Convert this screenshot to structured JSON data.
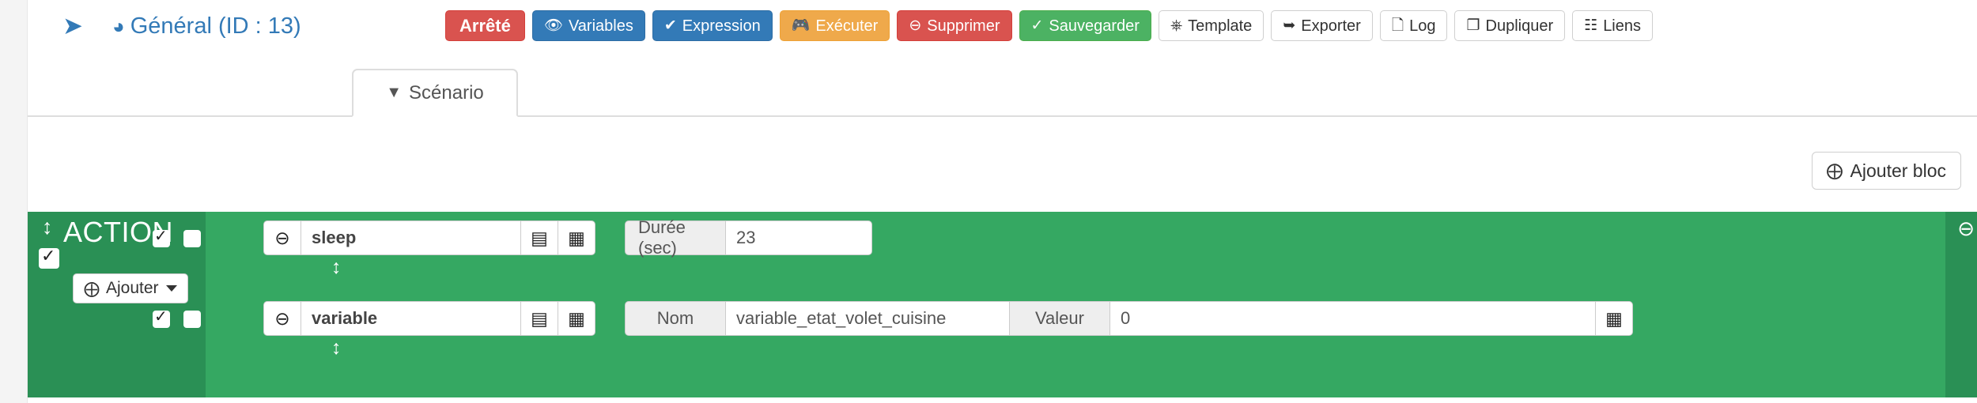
{
  "header": {
    "back_icon": "arrow-circle-left",
    "title": "Général (ID : 13)",
    "title_icon": "dashboard-icon",
    "buttons": [
      {
        "name": "status-badge",
        "label": "Arrêté",
        "icon": "",
        "style": "badge"
      },
      {
        "name": "variables-button",
        "label": "Variables",
        "icon": "eye-icon",
        "style": "primary"
      },
      {
        "name": "expression-button",
        "label": "Expression",
        "icon": "check-icon",
        "style": "primary"
      },
      {
        "name": "execute-button",
        "label": "Exécuter",
        "icon": "gamepad-icon",
        "style": "warning"
      },
      {
        "name": "delete-button",
        "label": "Supprimer",
        "icon": "minus-circle-icon",
        "style": "danger"
      },
      {
        "name": "save-button",
        "label": "Sauvegarder",
        "icon": "check-circle-icon",
        "style": "success"
      },
      {
        "name": "template-button",
        "label": "Template",
        "icon": "cubes-icon",
        "style": "default"
      },
      {
        "name": "export-button",
        "label": "Exporter",
        "icon": "share-icon",
        "style": "default"
      },
      {
        "name": "log-button",
        "label": "Log",
        "icon": "file-text-icon",
        "style": "default"
      },
      {
        "name": "duplicate-button",
        "label": "Dupliquer",
        "icon": "copy-icon",
        "style": "default"
      },
      {
        "name": "links-button",
        "label": "Liens",
        "icon": "object-group-icon",
        "style": "default"
      }
    ]
  },
  "tabs": [
    {
      "name": "tab-scenario",
      "label": "Scénario",
      "icon": "filter-icon",
      "active": true
    }
  ],
  "toolbar": {
    "add_block_label": "Ajouter bloc",
    "add_block_icon": "plus-circle-icon"
  },
  "block": {
    "title": "ACTION",
    "sort_icon": "arrows-v-icon",
    "enabled_checked": true,
    "add_label": "Ajouter",
    "add_icon": "plus-circle-icon",
    "remove_icon": "minus-circle-icon",
    "accent_color": "#35a862",
    "accent_dark_color": "#2a9055",
    "rows": [
      {
        "name": "action-row-sleep",
        "enabled_checked": true,
        "second_checked": false,
        "remove_icon": "minus-circle-icon",
        "action": "sleep",
        "icon_options": "sliders-icon",
        "icon_list": "list-alt-icon",
        "fields": [
          {
            "label": "Durée (sec)",
            "value": "23",
            "name": "duration-field"
          }
        ],
        "trailing_icon": null
      },
      {
        "name": "action-row-variable",
        "enabled_checked": true,
        "second_checked": false,
        "remove_icon": "minus-circle-icon",
        "action": "variable",
        "icon_options": "sliders-icon",
        "icon_list": "list-alt-icon",
        "fields": [
          {
            "label": "Nom",
            "value": "variable_etat_volet_cuisine",
            "name": "variable-name-field"
          },
          {
            "label": "Valeur",
            "value": "0",
            "name": "variable-value-field"
          }
        ],
        "trailing_icon": "list-alt-icon"
      }
    ]
  }
}
